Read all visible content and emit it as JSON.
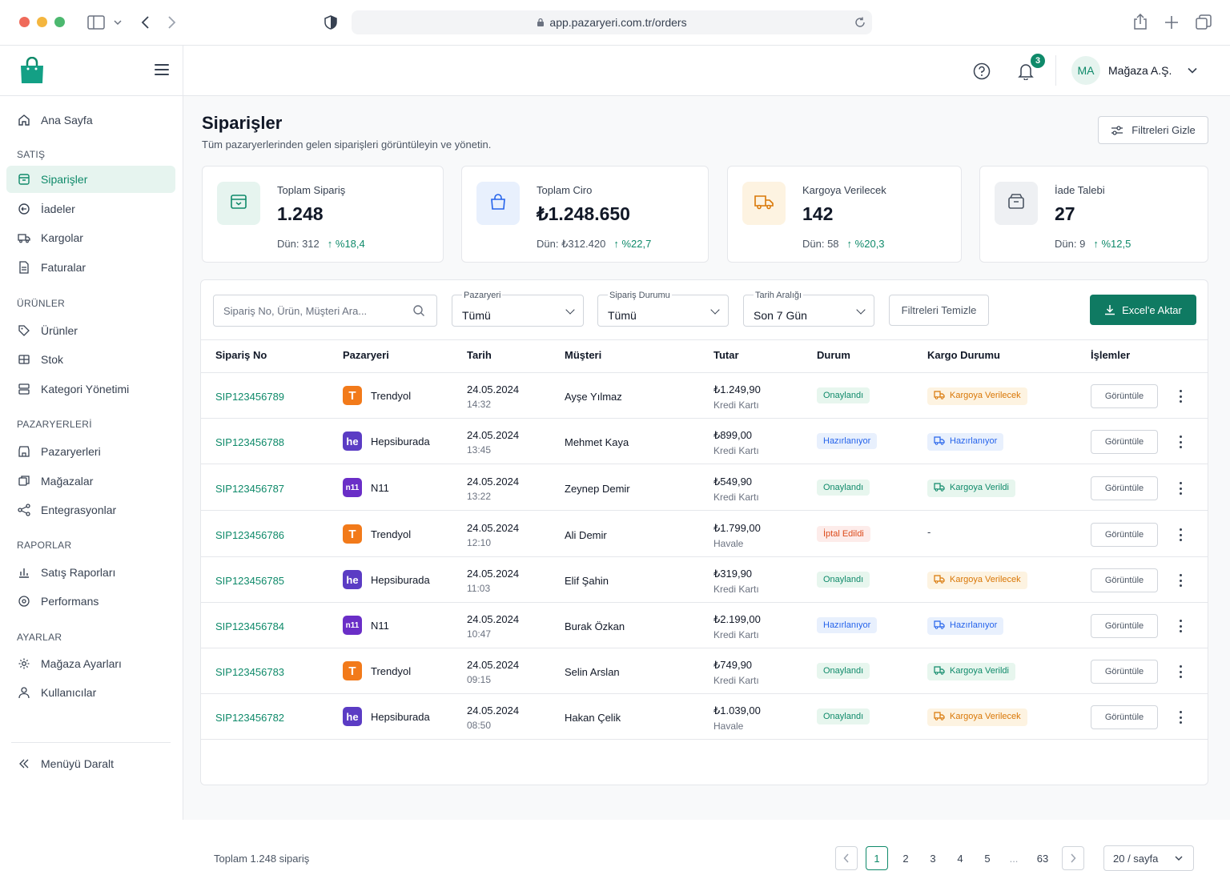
{
  "browser": {
    "url": "app.pazaryeri.com.tr/orders"
  },
  "header": {
    "notif_count": "3",
    "avatar_initials": "MA",
    "user_name": "Mağaza A.Ş."
  },
  "sidebar": {
    "home": "Ana Sayfa",
    "sec_satis": "SATIŞ",
    "siparisler": "Siparişler",
    "iadeler": "İadeler",
    "kargolar": "Kargolar",
    "faturalar": "Faturalar",
    "sec_urunler": "ÜRÜNLER",
    "urunler": "Ürünler",
    "stok": "Stok",
    "kategori": "Kategori Yönetimi",
    "sec_pazaryerleri": "PAZARYERLERİ",
    "pazaryerleri": "Pazaryerleri",
    "magazalar": "Mağazalar",
    "entegrasyonlar": "Entegrasyonlar",
    "sec_raporlar": "RAPORLAR",
    "satis_raporlari": "Satış Raporları",
    "performans": "Performans",
    "sec_ayarlar": "AYARLAR",
    "magaza_ayarlari": "Mağaza Ayarları",
    "kullanicilar": "Kullanıcılar",
    "collapse": "Menüyü Daralt"
  },
  "page": {
    "title": "Siparişler",
    "subtitle": "Tüm pazaryerlerinden gelen siparişleri görüntüleyin ve yönetin.",
    "hide_filters": "Filtreleri Gizle"
  },
  "stats": [
    {
      "label": "Toplam Sipariş",
      "value": "1.248",
      "prev": "Dün: 312",
      "change": "%18,4",
      "icon": "box-icon",
      "bg": "#e6f4ef",
      "color": "#0f8a6a"
    },
    {
      "label": "Toplam Ciro",
      "value": "₺1.248.650",
      "prev": "Dün: ₺312.420",
      "change": "%22,7",
      "icon": "shopping-bag-icon",
      "bg": "#e8f0fd",
      "color": "#2563eb"
    },
    {
      "label": "Kargoya Verilecek",
      "value": "142",
      "prev": "Dün: 58",
      "change": "%20,3",
      "icon": "truck-icon",
      "bg": "#fdf3e1",
      "color": "#d97706"
    },
    {
      "label": "İade Talebi",
      "value": "27",
      "prev": "Dün: 9",
      "change": "%12,5",
      "icon": "archive-icon",
      "bg": "#eef0f3",
      "color": "#4b5563"
    }
  ],
  "filters": {
    "search_placeholder": "Sipariş No, Ürün, Müşteri Ara...",
    "marketplace_label": "Pazaryeri",
    "marketplace_value": "Tümü",
    "status_label": "Sipariş Durumu",
    "status_value": "Tümü",
    "date_label": "Tarih Aralığı",
    "date_value": "Son 7 Gün",
    "clear": "Filtreleri Temizle",
    "export": "Excel'e Aktar"
  },
  "table": {
    "headers": [
      "Sipariş No",
      "Pazaryeri",
      "Tarih",
      "Müşteri",
      "Tutar",
      "Durum",
      "Kargo Durumu",
      "İşlemler"
    ],
    "view_label": "Görüntüle",
    "rows": [
      {
        "id": "SIP123456789",
        "mp": "Trendyol",
        "mp_mark": "T",
        "mp_color": "#f27a1a",
        "date": "24.05.2024",
        "time": "14:32",
        "customer": "Ayşe Yılmaz",
        "amount": "₺1.249,90",
        "pay": "Kredi Kartı",
        "status": "Onaylandı",
        "status_type": "on",
        "cargo": "Kargoya Verilecek",
        "cargo_type": "ver"
      },
      {
        "id": "SIP123456788",
        "mp": "Hepsiburada",
        "mp_mark": "he",
        "mp_color": "#5b3cc4",
        "date": "24.05.2024",
        "time": "13:45",
        "customer": "Mehmet Kaya",
        "amount": "₺899,00",
        "pay": "Kredi Kartı",
        "status": "Hazırlanıyor",
        "status_type": "hz",
        "cargo": "Hazırlanıyor",
        "cargo_type": "hz"
      },
      {
        "id": "SIP123456787",
        "mp": "N11",
        "mp_mark": "n11",
        "mp_color": "#6a2ec7",
        "date": "24.05.2024",
        "time": "13:22",
        "customer": "Zeynep Demir",
        "amount": "₺549,90",
        "pay": "Kredi Kartı",
        "status": "Onaylandı",
        "status_type": "on",
        "cargo": "Kargoya Verildi",
        "cargo_type": "vd"
      },
      {
        "id": "SIP123456786",
        "mp": "Trendyol",
        "mp_mark": "T",
        "mp_color": "#f27a1a",
        "date": "24.05.2024",
        "time": "12:10",
        "customer": "Ali Demir",
        "amount": "₺1.799,00",
        "pay": "Havale",
        "status": "İptal Edildi",
        "status_type": "ip",
        "cargo": "-",
        "cargo_type": "none"
      },
      {
        "id": "SIP123456785",
        "mp": "Hepsiburada",
        "mp_mark": "he",
        "mp_color": "#5b3cc4",
        "date": "24.05.2024",
        "time": "11:03",
        "customer": "Elif Şahin",
        "amount": "₺319,90",
        "pay": "Kredi Kartı",
        "status": "Onaylandı",
        "status_type": "on",
        "cargo": "Kargoya Verilecek",
        "cargo_type": "ver"
      },
      {
        "id": "SIP123456784",
        "mp": "N11",
        "mp_mark": "n11",
        "mp_color": "#6a2ec7",
        "date": "24.05.2024",
        "time": "10:47",
        "customer": "Burak Özkan",
        "amount": "₺2.199,00",
        "pay": "Kredi Kartı",
        "status": "Hazırlanıyor",
        "status_type": "hz",
        "cargo": "Hazırlanıyor",
        "cargo_type": "hz"
      },
      {
        "id": "SIP123456783",
        "mp": "Trendyol",
        "mp_mark": "T",
        "mp_color": "#f27a1a",
        "date": "24.05.2024",
        "time": "09:15",
        "customer": "Selin Arslan",
        "amount": "₺749,90",
        "pay": "Kredi Kartı",
        "status": "Onaylandı",
        "status_type": "on",
        "cargo": "Kargoya Verildi",
        "cargo_type": "vd"
      },
      {
        "id": "SIP123456782",
        "mp": "Hepsiburada",
        "mp_mark": "he",
        "mp_color": "#5b3cc4",
        "date": "24.05.2024",
        "time": "08:50",
        "customer": "Hakan Çelik",
        "amount": "₺1.039,00",
        "pay": "Havale",
        "status": "Onaylandı",
        "status_type": "on",
        "cargo": "Kargoya Verilecek",
        "cargo_type": "ver"
      }
    ]
  },
  "footer": {
    "total": "Toplam 1.248 sipariş",
    "pages": [
      "1",
      "2",
      "3",
      "4",
      "5",
      "...",
      "63"
    ],
    "current": "1",
    "per_page": "20 / sayfa"
  },
  "colors": {
    "accent": "#0f8a6a",
    "accent_bg": "#e6f4ef"
  }
}
